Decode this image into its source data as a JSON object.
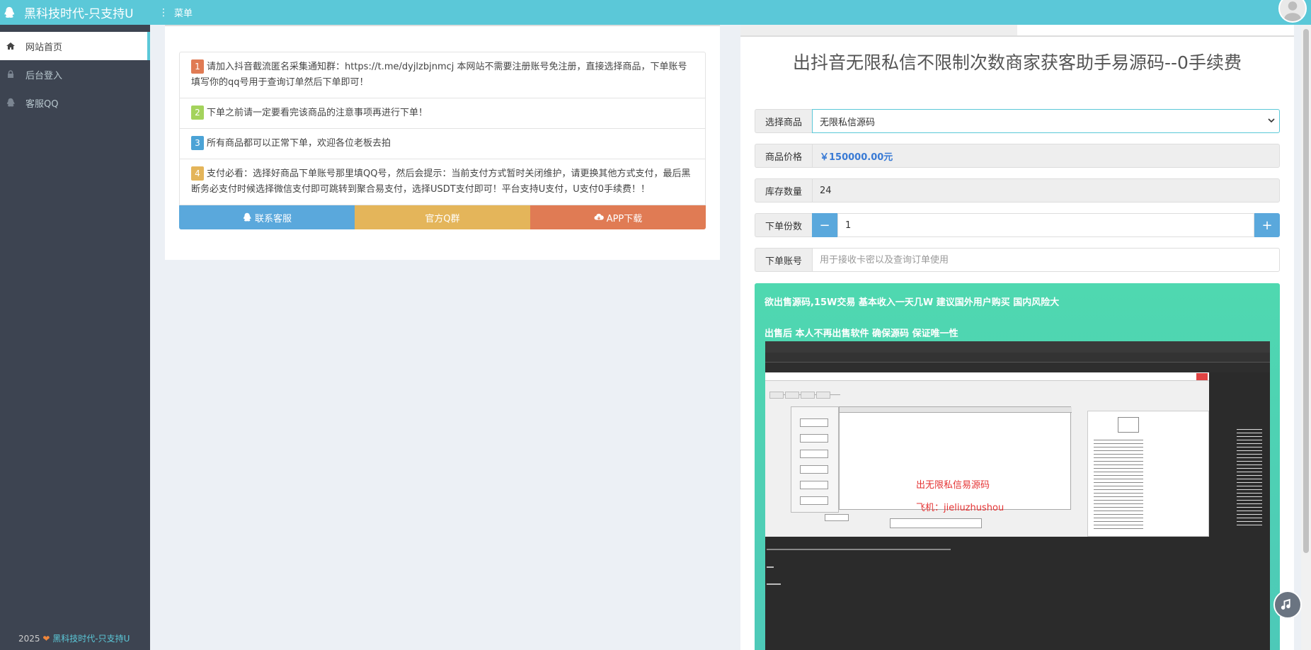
{
  "header": {
    "brand": "黑科技时代-只支持U",
    "menu_label": "菜单"
  },
  "sidebar": {
    "items": [
      {
        "label": "网站首页",
        "icon": "home-icon",
        "active": true
      },
      {
        "label": "后台登入",
        "icon": "lock-icon",
        "active": false
      },
      {
        "label": "客服QQ",
        "icon": "qq-icon",
        "active": false
      }
    ],
    "footer_year": "2025",
    "footer_brand": "黑科技时代-只支持U"
  },
  "notices": [
    {
      "num": "1",
      "text": "请加入抖音截流匿名采集通知群：https://t.me/dyjlzbjnmcj 本网站不需要注册账号免注册，直接选择商品，下单账号填写你的qq号用于查询订单然后下单即可！"
    },
    {
      "num": "2",
      "text": "下单之前请一定要看完该商品的注意事项再进行下单！"
    },
    {
      "num": "3",
      "text": "所有商品都可以正常下单，欢迎各位老板去拍"
    },
    {
      "num": "4",
      "text": "支付必看：选择好商品下单账号那里填QQ号，然后会提示：当前支付方式暂时关闭维护，请更换其他方式支付，最后黑断务必支付时候选择微信支付即可跳转到聚合易支付，选择USDT支付即可！平台支持U支付，U支付0手续费！！"
    }
  ],
  "actions": {
    "contact": "联系客服",
    "qgroup": "官方Q群",
    "app": "APP下载"
  },
  "product": {
    "title": "出抖音无限私信不限制次数商家获客助手易源码--0手续费",
    "labels": {
      "select": "选择商品",
      "price": "商品价格",
      "stock": "库存数量",
      "qty": "下单份数",
      "account": "下单账号"
    },
    "selected": "无限私信源码",
    "price": "￥150000.00元",
    "stock": "24",
    "quantity": "1",
    "account_placeholder": "用于接收卡密以及查询订单使用",
    "desc_line1": "欲出售源码,15W交易 基本收入一天几W 建议国外用户购买 国内风险大",
    "desc_line2": "出售后 本人不再出售软件 确保源码 保证唯一性",
    "shot_text1": "出无限私信易源码",
    "shot_text2": "飞机：jieliuzhushou"
  },
  "colors": {
    "header": "#5bc8d8",
    "sidebar": "#3d4451",
    "accent_blue": "#5aa8dc",
    "accent_yellow": "#e4b55a",
    "accent_orange": "#e07b54",
    "desc_bg": "#4fd8b0"
  }
}
